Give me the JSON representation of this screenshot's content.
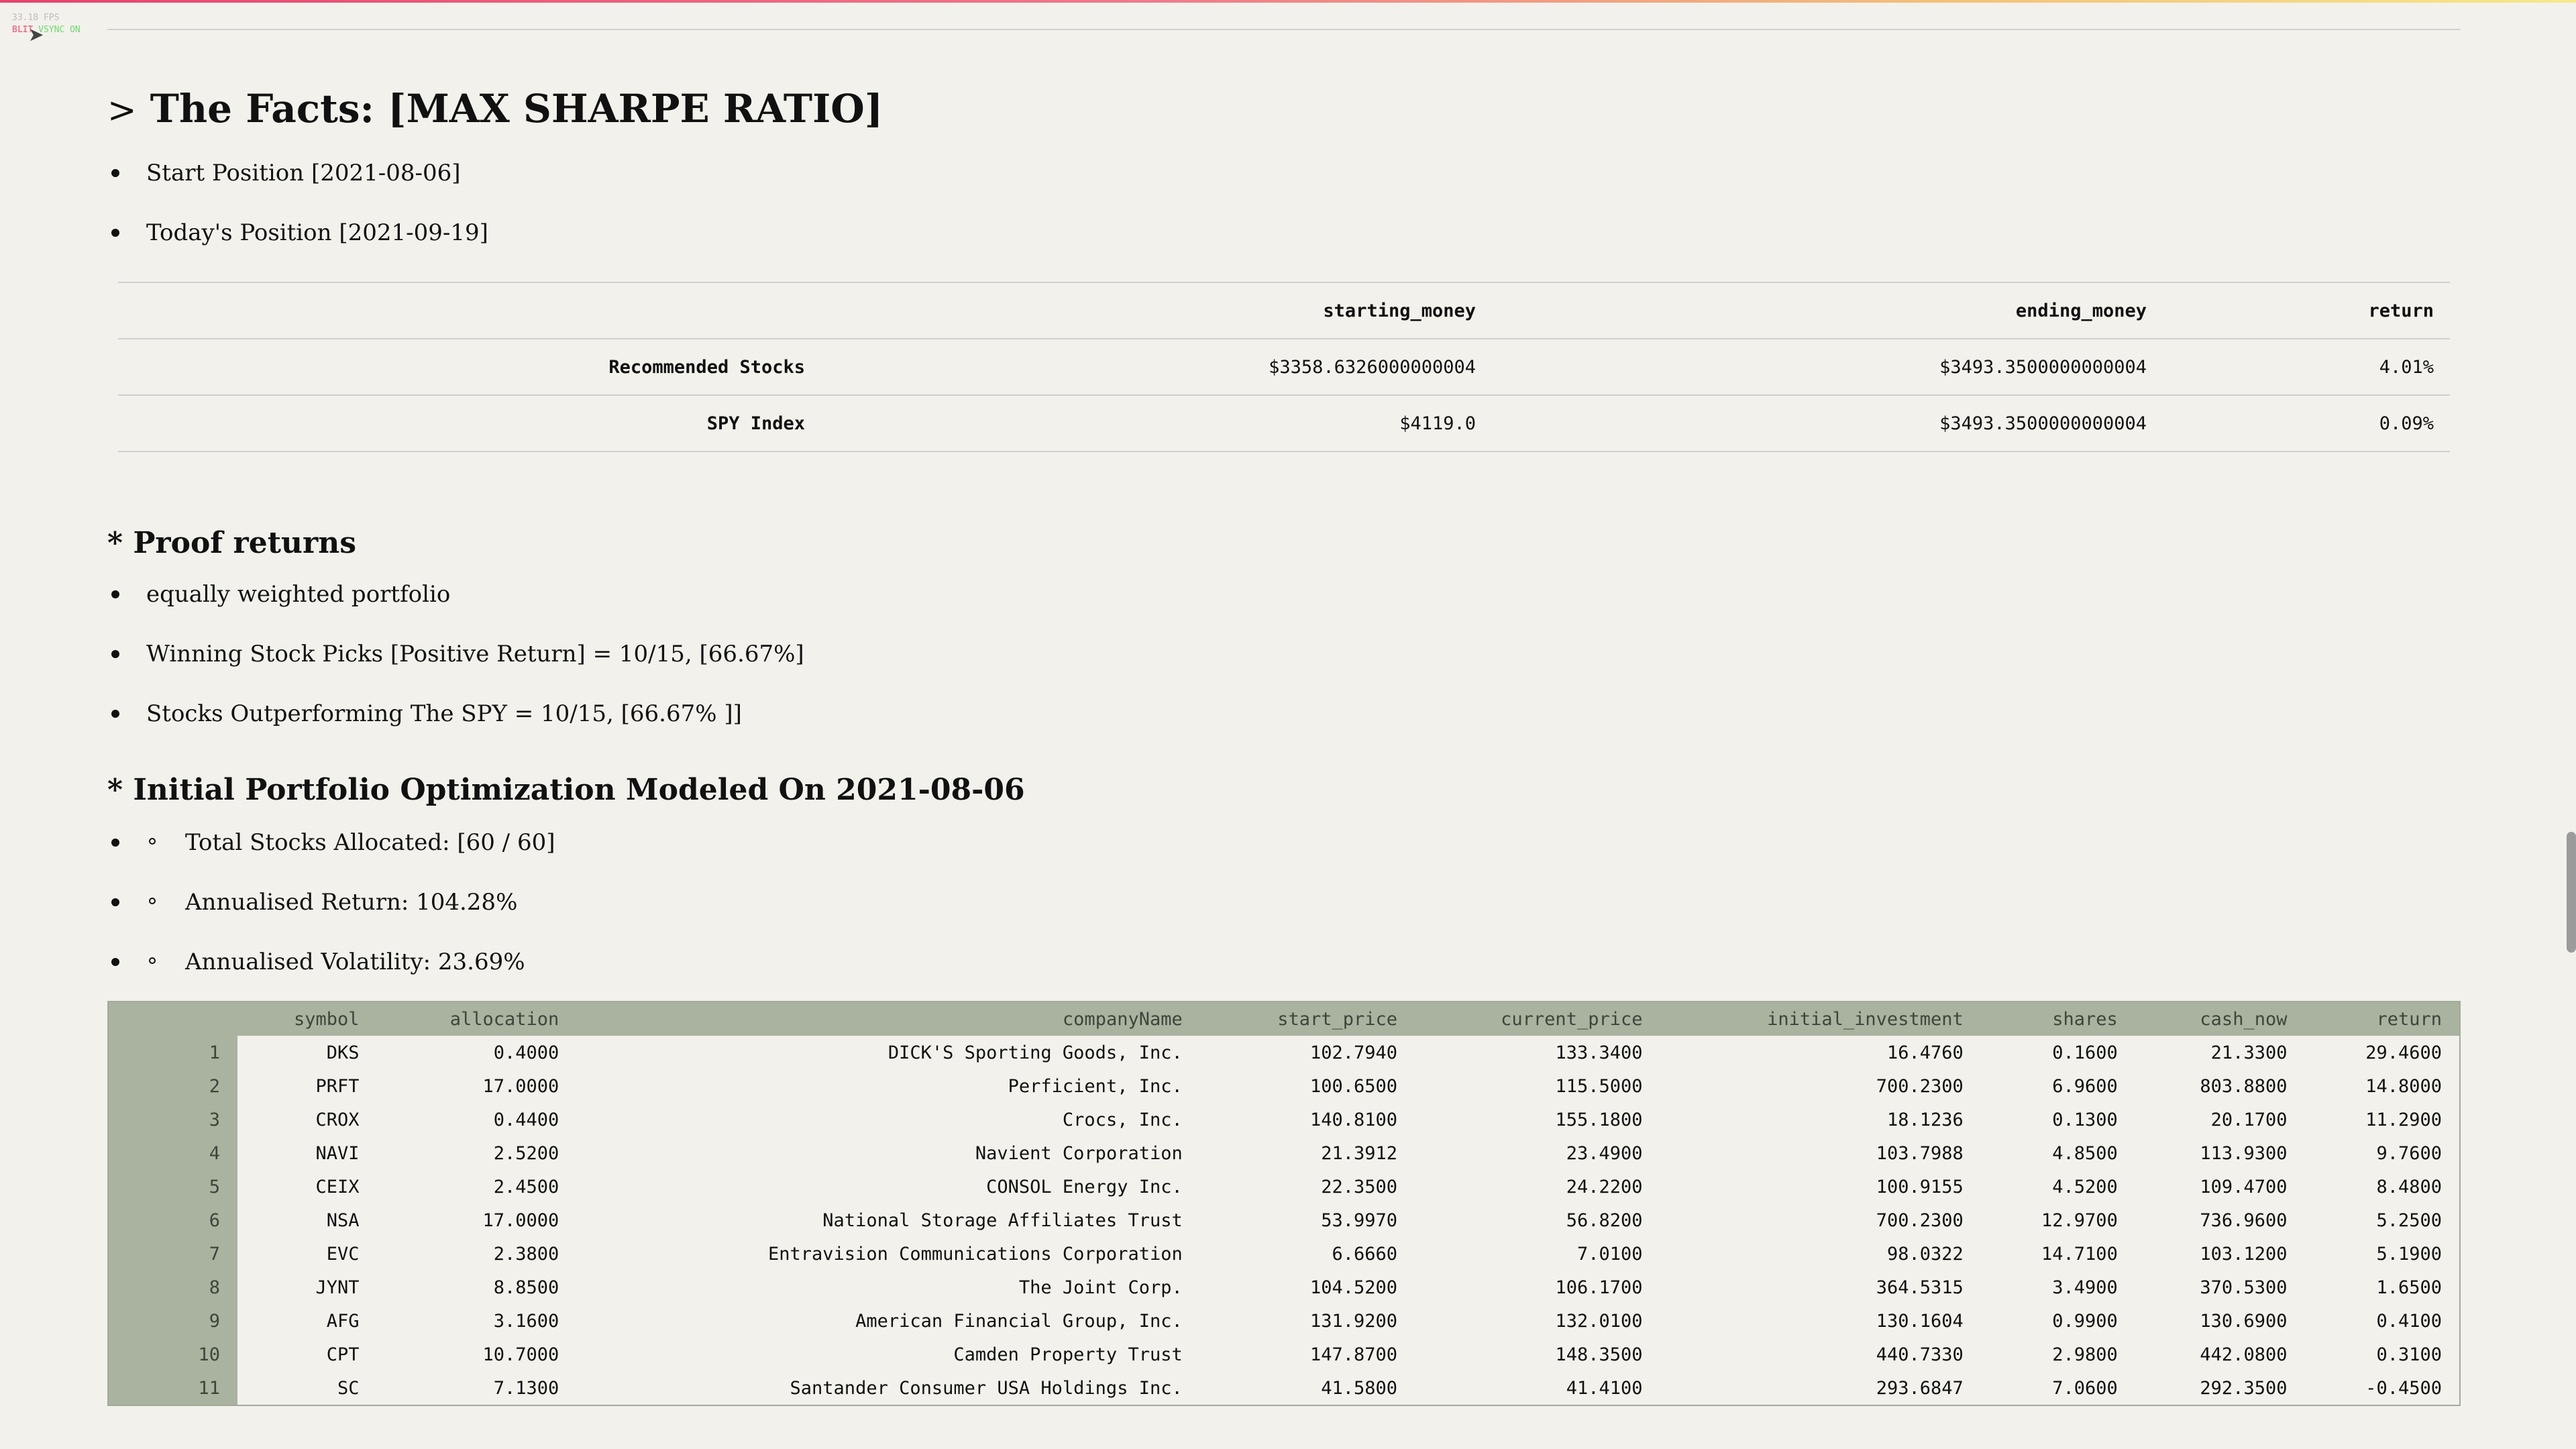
{
  "hud": {
    "fps_line": "33.18 FPS",
    "blit_label": "BLIT",
    "vsync_label": "VSYNC ON"
  },
  "toggle_icon": "chevron-right-icon",
  "title": {
    "prefix": ">",
    "text": "The Facts: [MAX SHARPE RATIO]"
  },
  "facts_bullets": [
    "Start Position [2021-08-06]",
    "Today's Position [2021-09-19]"
  ],
  "facts_table": {
    "columns": [
      "starting_money",
      "ending_money",
      "return"
    ],
    "rows": [
      {
        "label": "Recommended Stocks",
        "starting_money": "$3358.6326000000004",
        "ending_money": "$3493.3500000000004",
        "return": "4.01%"
      },
      {
        "label": "SPY Index",
        "starting_money": "$4119.0",
        "ending_money": "$3493.3500000000004",
        "return": "0.09%"
      }
    ]
  },
  "proof": {
    "heading": "* Proof returns",
    "bullets": [
      "equally weighted portfolio",
      "Winning Stock Picks [Positive Return] = 10/15, [66.67%]",
      "Stocks Outperforming The SPY = 10/15, [66.67% ]]"
    ]
  },
  "optimization": {
    "heading": "* Initial Portfolio Optimization Modeled On 2021-08-06",
    "bullets": [
      "Total Stocks Allocated: [60 / 60]",
      "Annualised Return: 104.28%",
      "Annualised Volatility: 23.69%"
    ]
  },
  "portfolio_table": {
    "columns": [
      "symbol",
      "allocation",
      "companyName",
      "start_price",
      "current_price",
      "initial_investment",
      "shares",
      "cash_now",
      "return"
    ],
    "rows": [
      [
        "1",
        "DKS",
        "0.4000",
        "DICK'S Sporting Goods, Inc.",
        "102.7940",
        "133.3400",
        "16.4760",
        "0.1600",
        "21.3300",
        "29.4600"
      ],
      [
        "2",
        "PRFT",
        "17.0000",
        "Perficient, Inc.",
        "100.6500",
        "115.5000",
        "700.2300",
        "6.9600",
        "803.8800",
        "14.8000"
      ],
      [
        "3",
        "CROX",
        "0.4400",
        "Crocs, Inc.",
        "140.8100",
        "155.1800",
        "18.1236",
        "0.1300",
        "20.1700",
        "11.2900"
      ],
      [
        "4",
        "NAVI",
        "2.5200",
        "Navient Corporation",
        "21.3912",
        "23.4900",
        "103.7988",
        "4.8500",
        "113.9300",
        "9.7600"
      ],
      [
        "5",
        "CEIX",
        "2.4500",
        "CONSOL Energy Inc.",
        "22.3500",
        "24.2200",
        "100.9155",
        "4.5200",
        "109.4700",
        "8.4800"
      ],
      [
        "6",
        "NSA",
        "17.0000",
        "National Storage Affiliates Trust",
        "53.9970",
        "56.8200",
        "700.2300",
        "12.9700",
        "736.9600",
        "5.2500"
      ],
      [
        "7",
        "EVC",
        "2.3800",
        "Entravision Communications Corporation",
        "6.6660",
        "7.0100",
        "98.0322",
        "14.7100",
        "103.1200",
        "5.1900"
      ],
      [
        "8",
        "JYNT",
        "8.8500",
        "The Joint Corp.",
        "104.5200",
        "106.1700",
        "364.5315",
        "3.4900",
        "370.5300",
        "1.6500"
      ],
      [
        "9",
        "AFG",
        "3.1600",
        "American Financial Group, Inc.",
        "131.9200",
        "132.0100",
        "130.1604",
        "0.9900",
        "130.6900",
        "0.4100"
      ],
      [
        "10",
        "CPT",
        "10.7000",
        "Camden Property Trust",
        "147.8700",
        "148.3500",
        "440.7330",
        "2.9800",
        "442.0800",
        "0.3100"
      ],
      [
        "11",
        "SC",
        "7.1300",
        "Santander Consumer USA Holdings Inc.",
        "41.5800",
        "41.4100",
        "293.6847",
        "7.0600",
        "292.3500",
        "-0.4500"
      ]
    ]
  }
}
